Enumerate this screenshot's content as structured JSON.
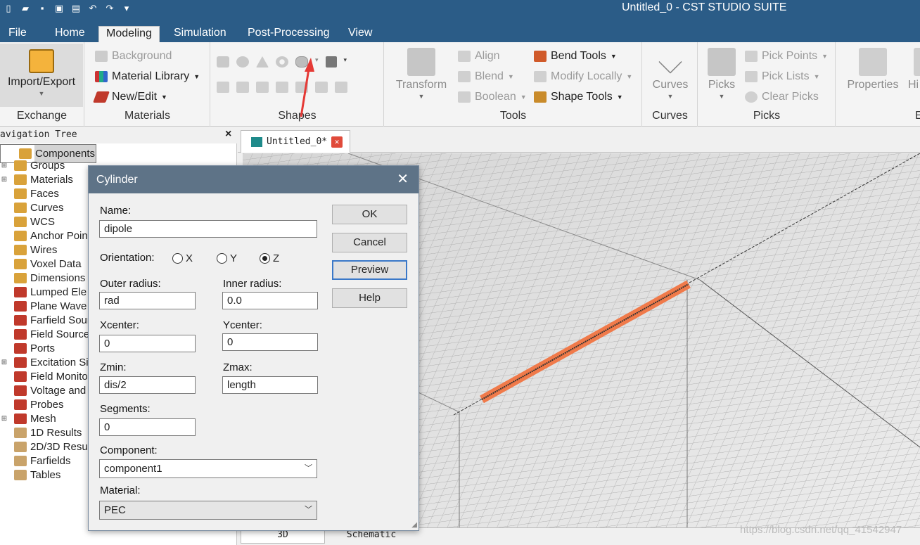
{
  "window": {
    "title": "Untitled_0 - CST STUDIO SUITE"
  },
  "menu_tabs": [
    "File",
    "Home",
    "Modeling",
    "Simulation",
    "Post-Processing",
    "View"
  ],
  "ribbon": {
    "exchange": {
      "label": "Exchange",
      "import_export": "Import/Export"
    },
    "materials": {
      "label": "Materials",
      "background": "Background",
      "material_library": "Material Library",
      "new_edit": "New/Edit"
    },
    "shapes": {
      "label": "Shapes"
    },
    "tools": {
      "label": "Tools",
      "transform": "Transform",
      "align": "Align",
      "blend": "Blend",
      "boolean": "Boolean",
      "bend_tools": "Bend Tools",
      "modify_locally": "Modify Locally",
      "shape_tools": "Shape Tools"
    },
    "curves": {
      "label": "Curves",
      "curves": "Curves"
    },
    "picks": {
      "label": "Picks",
      "picks": "Picks",
      "pick_points": "Pick Points",
      "pick_lists": "Pick Lists",
      "clear_picks": "Clear Picks"
    },
    "properties": {
      "label": "E",
      "properties": "Properties",
      "history": "Hi"
    }
  },
  "nav": {
    "title": "avigation Tree",
    "items": [
      "Components",
      "Groups",
      "Materials",
      "Faces",
      "Curves",
      "WCS",
      "Anchor Poin",
      "Wires",
      "Voxel Data",
      "Dimensions",
      "Lumped Ele",
      "Plane Wave",
      "Farfield Sour",
      "Field Source",
      "Ports",
      "Excitation Si",
      "Field Monito",
      "Voltage and",
      "Probes",
      "Mesh",
      "1D Results",
      "2D/3D Resul",
      "Farfields",
      "Tables"
    ]
  },
  "document": {
    "tab": "Untitled_0*",
    "bottom_tabs": [
      "3D",
      "Schematic"
    ]
  },
  "watermark": "https://blog.csdn.net/qq_41542947",
  "dialog": {
    "title": "Cylinder",
    "name_label": "Name:",
    "name_value": "dipole",
    "orientation_label": "Orientation:",
    "orientation_options": [
      "X",
      "Y",
      "Z"
    ],
    "orientation_selected": "Z",
    "outer_radius_label": "Outer radius:",
    "outer_radius_value": "rad",
    "inner_radius_label": "Inner radius:",
    "inner_radius_value": "0.0",
    "xcenter_label": "Xcenter:",
    "xcenter_value": "0",
    "ycenter_label": "Ycenter:",
    "ycenter_value": "0",
    "zmin_label": "Zmin:",
    "zmin_value": "dis/2",
    "zmax_label": "Zmax:",
    "zmax_value": "length",
    "segments_label": "Segments:",
    "segments_value": "0",
    "component_label": "Component:",
    "component_value": "component1",
    "material_label": "Material:",
    "material_value": "PEC",
    "buttons": {
      "ok": "OK",
      "cancel": "Cancel",
      "preview": "Preview",
      "help": "Help"
    }
  },
  "colors": {
    "titlebar": "#2b5c87",
    "dialog_title": "#5e7387",
    "highlight": "#f07a4a",
    "annotation_arrow": "#e53935"
  }
}
